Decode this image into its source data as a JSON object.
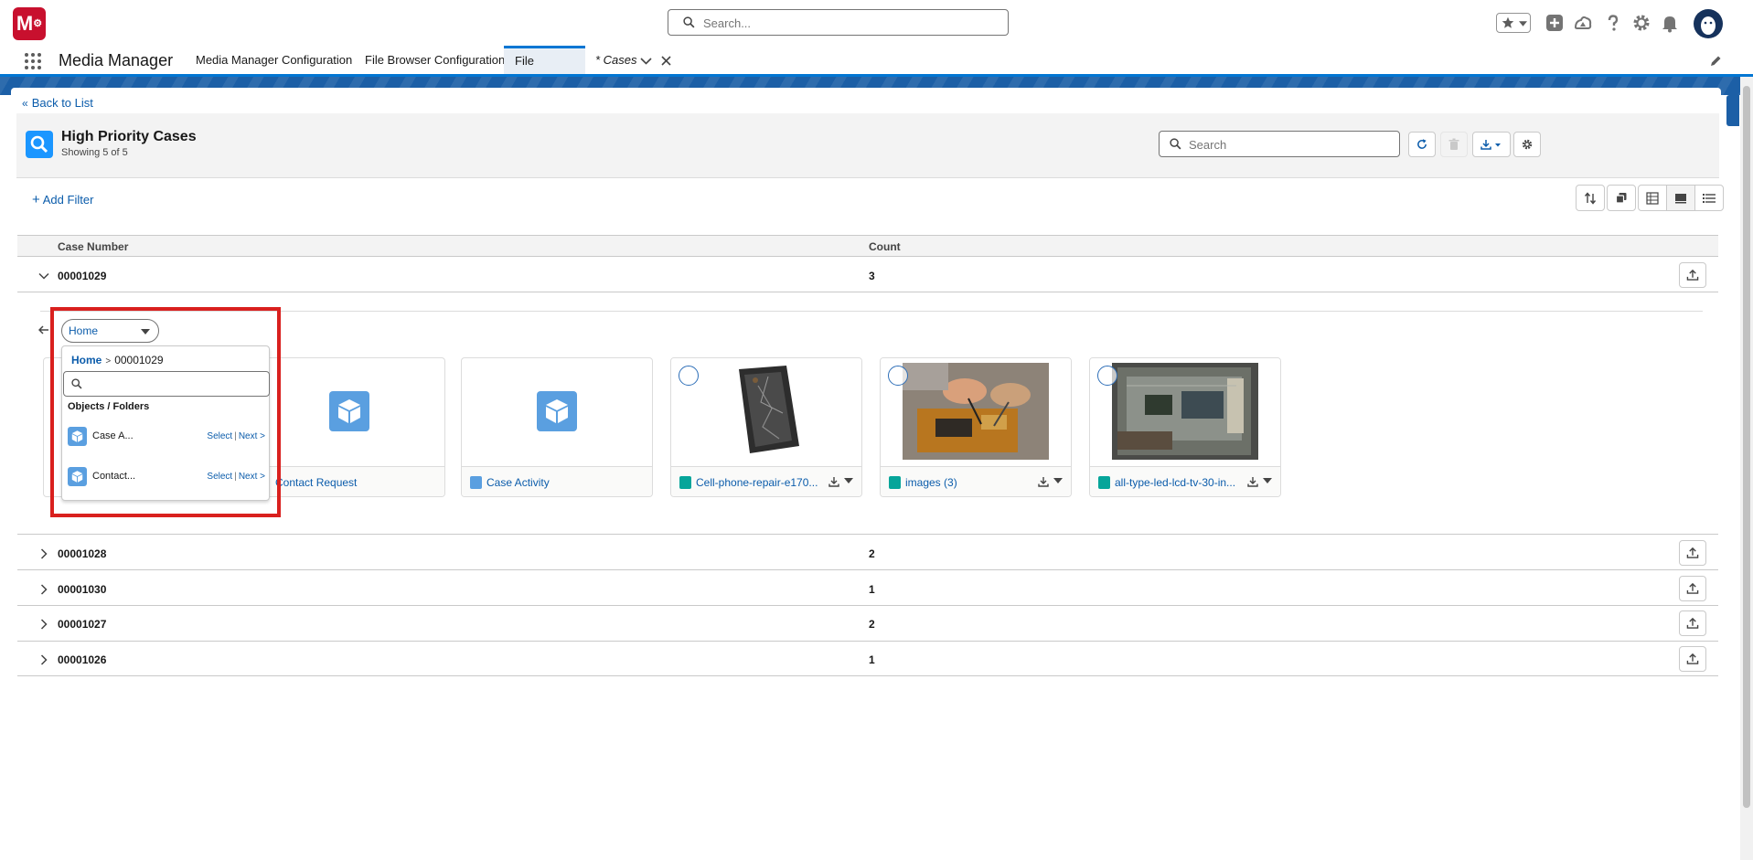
{
  "global_header": {
    "logo_text": "M",
    "search_placeholder": "Search..."
  },
  "app_nav": {
    "app_name": "Media Manager",
    "tabs": [
      {
        "label": "Media Manager Configuration"
      },
      {
        "label": "File Browser Configuration"
      },
      {
        "label": "File Browser"
      },
      {
        "label": "* Cases"
      }
    ]
  },
  "list": {
    "back_label": "Back to List",
    "title": "High Priority Cases",
    "subtitle": "Showing 5 of 5",
    "search_placeholder": "Search",
    "add_filter_label": "Add Filter"
  },
  "table": {
    "columns": [
      "Case Number",
      "Count"
    ],
    "rows": [
      {
        "case_number": "00001029",
        "count": "3",
        "expanded": true
      },
      {
        "case_number": "00001028",
        "count": "2",
        "expanded": false
      },
      {
        "case_number": "00001030",
        "count": "1",
        "expanded": false
      },
      {
        "case_number": "00001027",
        "count": "2",
        "expanded": false
      },
      {
        "case_number": "00001026",
        "count": "1",
        "expanded": false
      }
    ]
  },
  "folder_dropdown": {
    "selected": "Home",
    "breadcrumb_home": "Home",
    "breadcrumb_sep": ">",
    "breadcrumb_current": "00001029",
    "search_value": "",
    "section_label": "Objects / Folders",
    "items": [
      {
        "label": "Case A...",
        "select": "Select",
        "sep": "|",
        "next": "Next >"
      },
      {
        "label": "Contact...",
        "select": "Select",
        "sep": "|",
        "next": "Next >"
      }
    ]
  },
  "tiles": [
    {
      "name": "Contact Request",
      "kind": "folder"
    },
    {
      "name": "Case Activity",
      "kind": "folder"
    },
    {
      "name": "Cell-phone-repair-e170...",
      "kind": "image"
    },
    {
      "name": "images (3)",
      "kind": "image"
    },
    {
      "name": "all-type-led-lcd-tv-30-in...",
      "kind": "image"
    }
  ],
  "colors": {
    "brand": "#0176d3",
    "link": "#0b5cab",
    "highlight": "#d9201e",
    "logo": "#c8102e"
  }
}
